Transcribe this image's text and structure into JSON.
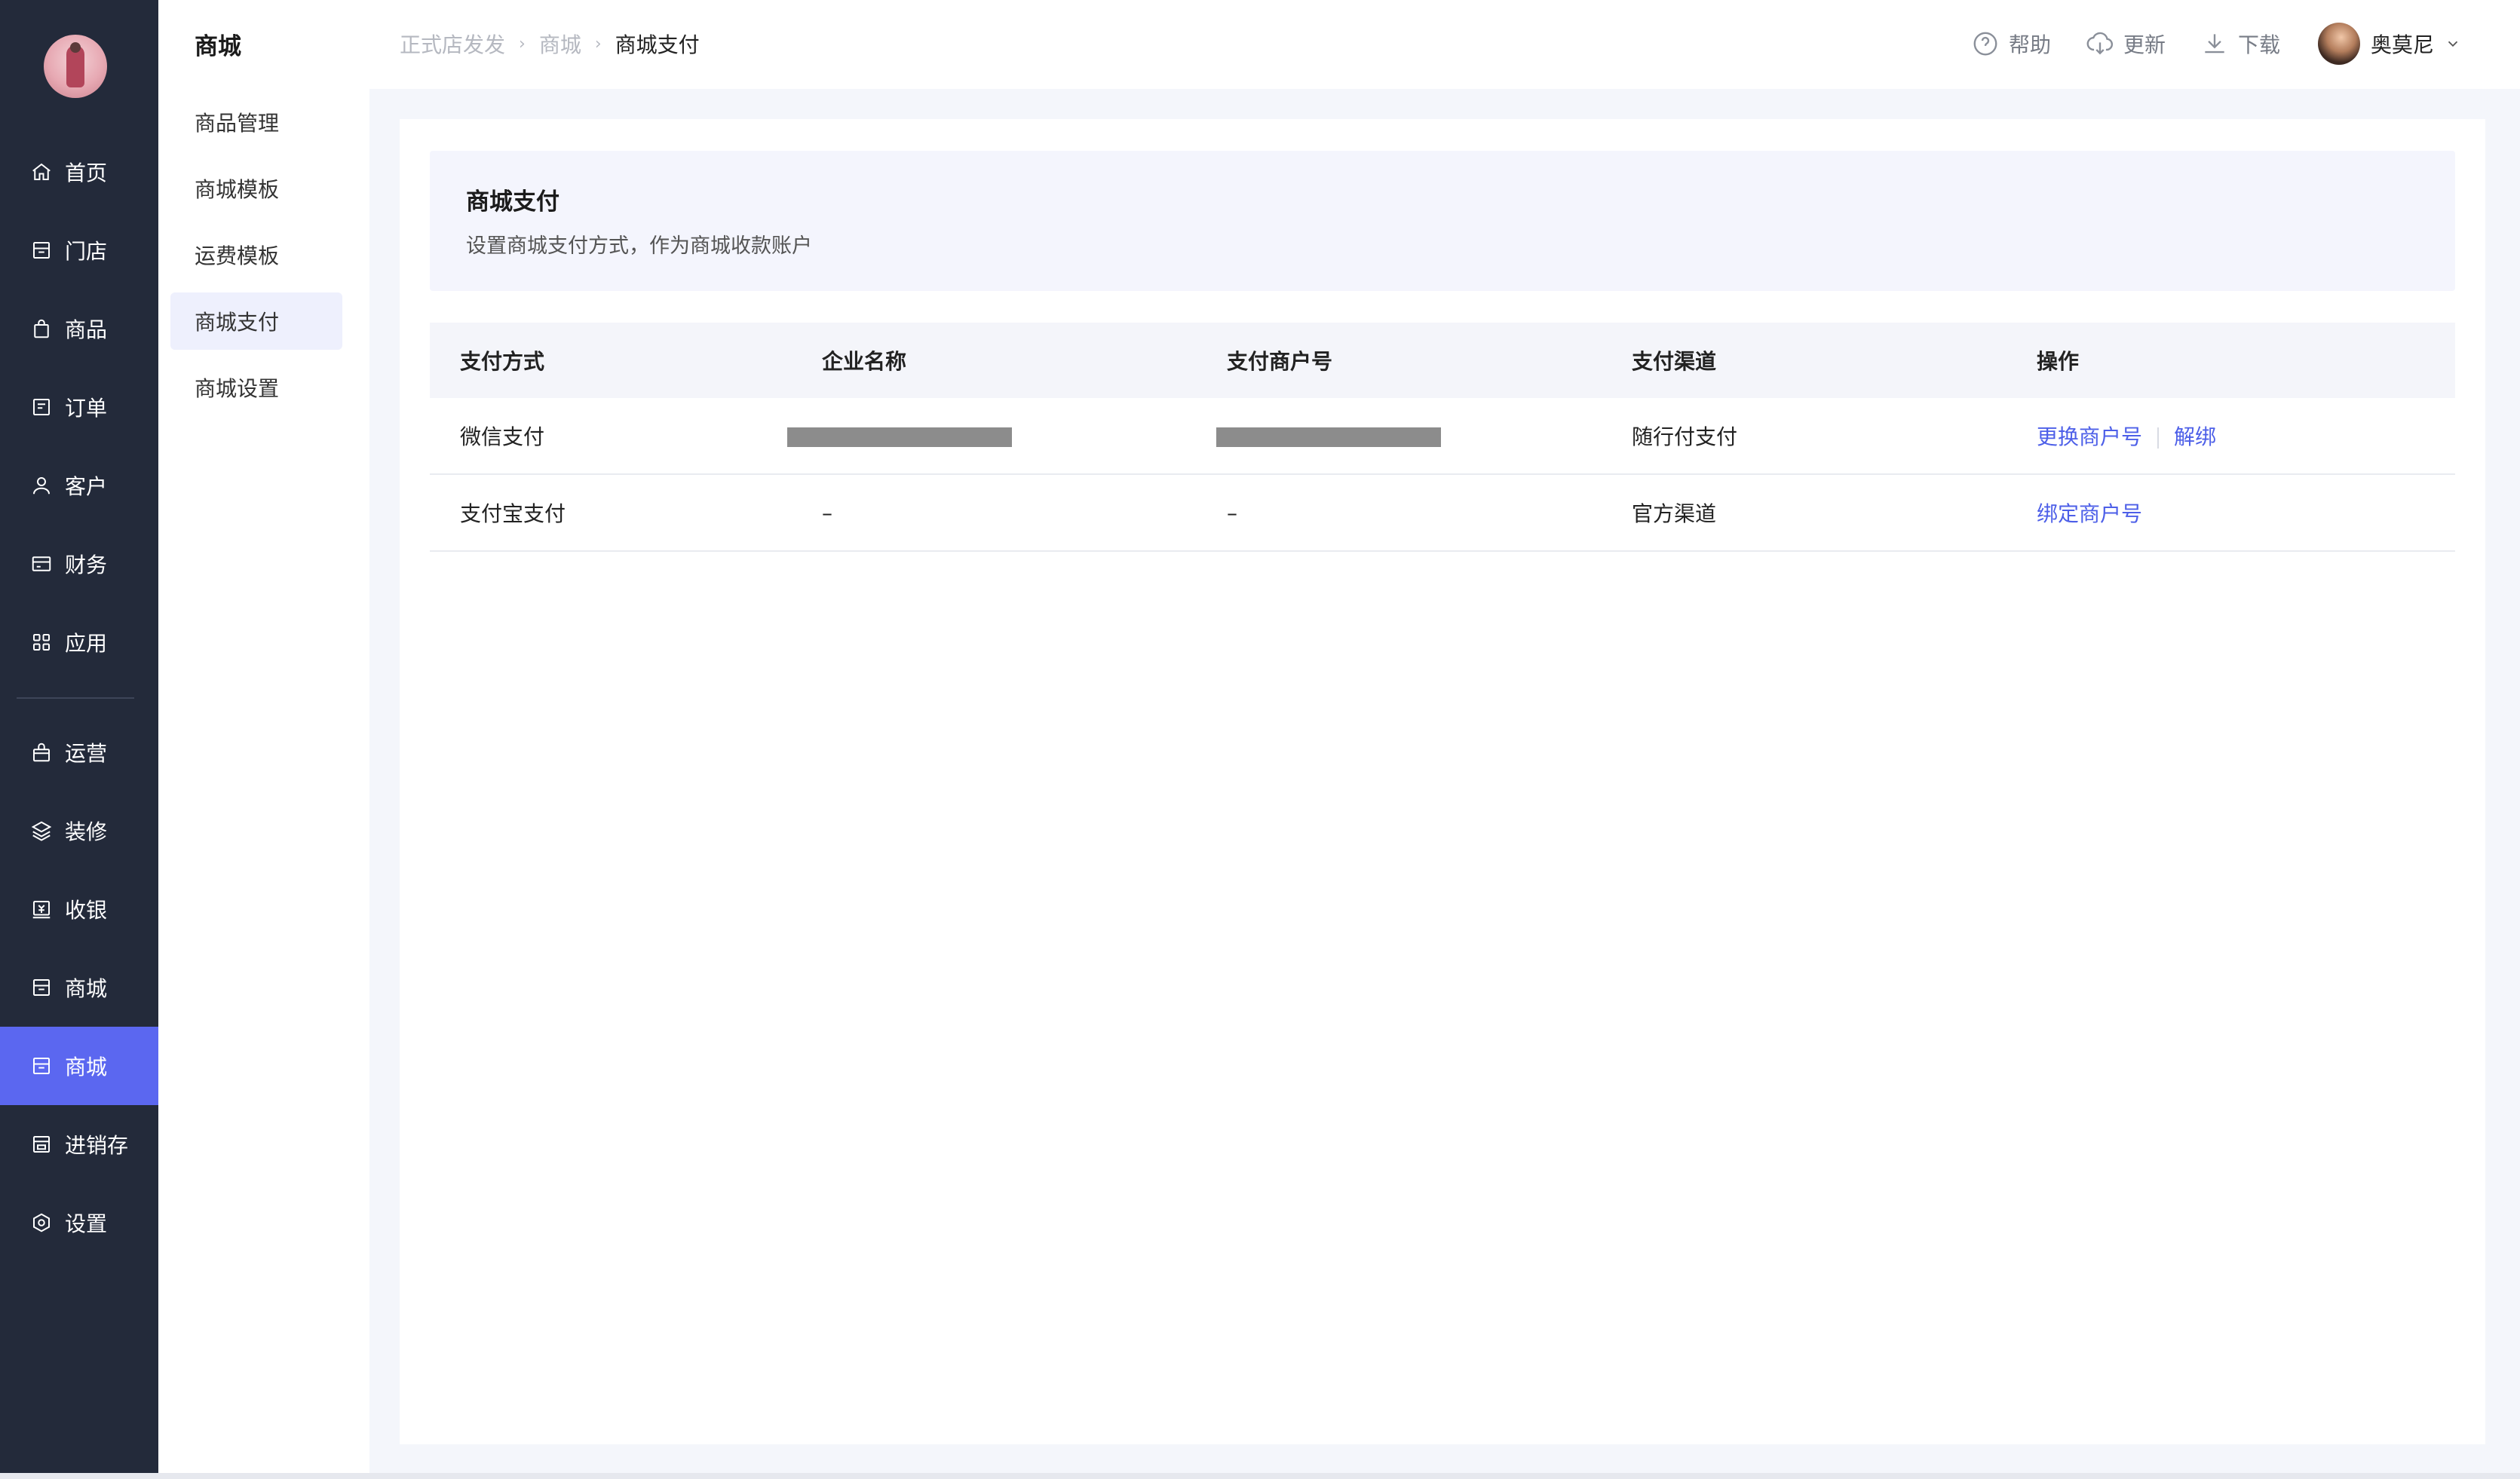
{
  "nav": {
    "items": [
      {
        "label": "首页",
        "icon": "home-icon"
      },
      {
        "label": "门店",
        "icon": "store-icon"
      },
      {
        "label": "商品",
        "icon": "bag-icon"
      },
      {
        "label": "订单",
        "icon": "order-icon"
      },
      {
        "label": "客户",
        "icon": "user-icon"
      },
      {
        "label": "财务",
        "icon": "card-icon"
      },
      {
        "label": "应用",
        "icon": "apps-icon"
      },
      {
        "label": "运营",
        "icon": "gift-icon"
      },
      {
        "label": "装修",
        "icon": "layers-icon"
      },
      {
        "label": "收银",
        "icon": "cashier-icon"
      },
      {
        "label": "商城",
        "icon": "shop-icon"
      },
      {
        "label": "商城",
        "icon": "shop-icon"
      },
      {
        "label": "进销存",
        "icon": "inventory-icon"
      },
      {
        "label": "设置",
        "icon": "settings-icon"
      }
    ],
    "active_index": 11,
    "accent_color": "#5b67f0",
    "bg_color": "#232a3a"
  },
  "subnav": {
    "title": "商城",
    "items": [
      "商品管理",
      "商城模板",
      "运费模板",
      "商城支付",
      "商城设置"
    ],
    "active_index": 3
  },
  "header": {
    "breadcrumb": [
      "正式店发发",
      "商城",
      "商城支付"
    ],
    "help_label": "帮助",
    "update_label": "更新",
    "download_label": "下载",
    "user_name": "奥莫尼"
  },
  "banner": {
    "title": "商城支付",
    "description": "设置商城支付方式，作为商城收款账户"
  },
  "table": {
    "columns": [
      "支付方式",
      "企业名称",
      "支付商户号",
      "支付渠道",
      "操作"
    ],
    "rows": [
      {
        "method": "微信支付",
        "company": "",
        "merchant_no": "",
        "channel": "随行付支付",
        "actions": [
          "更换商户号",
          "解绑"
        ]
      },
      {
        "method": "支付宝支付",
        "company": "–",
        "merchant_no": "–",
        "channel": "官方渠道",
        "actions": [
          "绑定商户号"
        ]
      }
    ]
  },
  "link_color": "#4d5fe8"
}
